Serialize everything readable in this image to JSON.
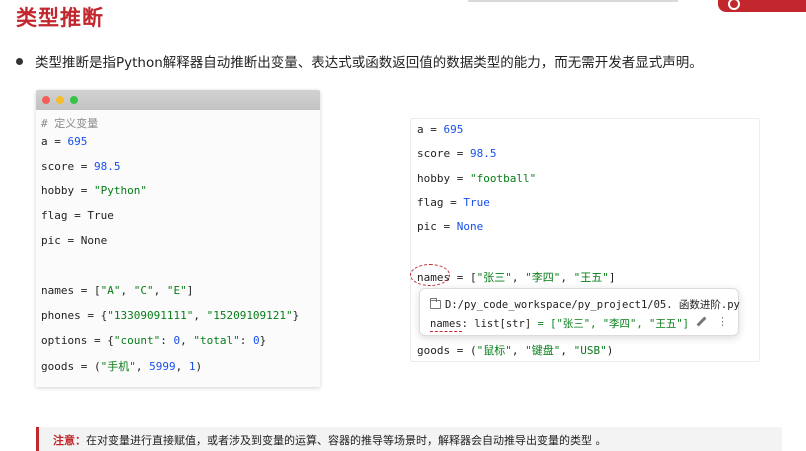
{
  "header": {
    "title": "类型推断"
  },
  "intro": {
    "text": "类型推断是指Python解释器自动推断出变量、表达式或函数返回值的数据类型的能力，而无需开发者显式声明。"
  },
  "left_code": {
    "comment": "# 定义变量",
    "lines": [
      {
        "var": "a = ",
        "val": "695",
        "kind": "num"
      },
      {
        "var": "score = ",
        "val": "98.5",
        "kind": "num"
      },
      {
        "var": "hobby = ",
        "val": "\"Python\"",
        "kind": "str"
      },
      {
        "var": "flag = ",
        "val": "True",
        "kind": "kw"
      },
      {
        "var": "pic = ",
        "val": "None",
        "kind": "kw"
      }
    ],
    "names": {
      "pre": "names = [",
      "items": [
        "\"A\"",
        "\"C\"",
        "\"E\""
      ],
      "post": "]"
    },
    "phones": {
      "pre": "phones = {",
      "items": [
        "\"13309091111\"",
        "\"15209109121\""
      ],
      "post": "}"
    },
    "options": {
      "pre": "options = {",
      "k1": "\"count\"",
      "v1": "0",
      "k2": "\"total\"",
      "v2": "0",
      "post": "}"
    },
    "goods": {
      "pre": "goods = (",
      "s1": "\"手机\"",
      "n1": "5999",
      "n2": "1",
      "post": ")"
    }
  },
  "right_code": {
    "lines": [
      {
        "var": "a = ",
        "val": "695",
        "kind": "num"
      },
      {
        "var": "score = ",
        "val": "98.5",
        "kind": "num"
      },
      {
        "var": "hobby = ",
        "val": "\"football\"",
        "kind": "str"
      },
      {
        "var": "flag = ",
        "val": "True",
        "kind": "num"
      },
      {
        "var": "pic = ",
        "val": "None",
        "kind": "num"
      }
    ],
    "names": {
      "name": "names",
      "pre": " = [",
      "items": [
        "\"张三\"",
        "\"李四\"",
        "\"王五\""
      ],
      "post": "]"
    },
    "goods": {
      "pre": "goods = (",
      "items": [
        "\"鼠标\"",
        "\"键盘\"",
        "\"USB\""
      ],
      "post": ")"
    }
  },
  "tooltip": {
    "path": "D:/py_code_workspace/py_project1/05. 函数进阶.py",
    "sig_name": "names",
    "sig_type": ": list[str]",
    "sig_value": " = [\"张三\", \"李四\", \"王五\"]",
    "more_icon": "⋮"
  },
  "note": {
    "label": "注意：",
    "text": "在对变量进行直接赋值，或者涉及到变量的运算、容器的推导等场景时，解释器会自动推导出变量的类型 。"
  },
  "colors": {
    "accent": "#c1272d",
    "number": "#1750eb",
    "string": "#067d17"
  },
  "icons": [
    "folder-icon",
    "pencil-icon",
    "more-vertical-icon"
  ]
}
